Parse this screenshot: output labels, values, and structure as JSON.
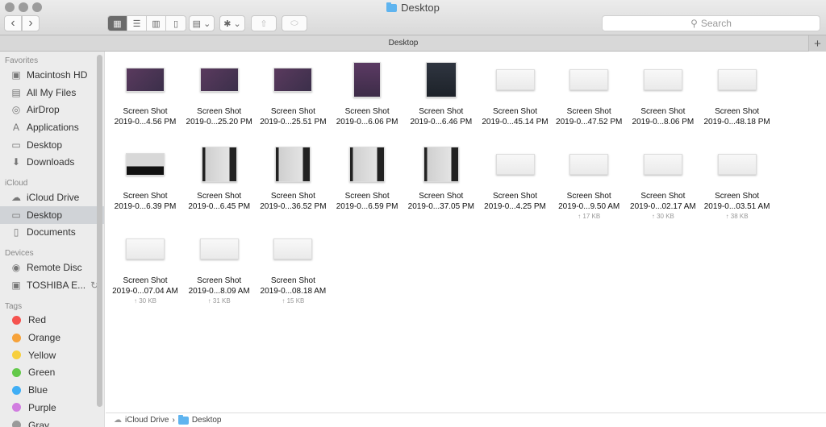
{
  "window": {
    "title": "Desktop",
    "icon": "folder-icon"
  },
  "toolbar": {
    "back_icon": "‹",
    "forward_icon": "›",
    "view_modes": [
      {
        "name": "icon-view",
        "glyph": "▦",
        "active": true
      },
      {
        "name": "list-view",
        "glyph": "☰"
      },
      {
        "name": "column-view",
        "glyph": "▥"
      },
      {
        "name": "gallery-view",
        "glyph": "▯"
      }
    ],
    "arrange_glyph": "▤ ⌄",
    "action_glyph": "✱ ⌄",
    "share_glyph": "⇧",
    "tag_glyph": "⬭",
    "search_placeholder": "Search",
    "search_icon": "⚲"
  },
  "pathbar": {
    "title": "Desktop",
    "add_tab": "+"
  },
  "sidebar": {
    "favorites_label": "Favorites",
    "favorites": [
      {
        "label": "Macintosh HD",
        "icon": "▣"
      },
      {
        "label": "All My Files",
        "icon": "▤"
      },
      {
        "label": "AirDrop",
        "icon": "◎"
      },
      {
        "label": "Applications",
        "icon": "A"
      },
      {
        "label": "Desktop",
        "icon": "▭"
      },
      {
        "label": "Downloads",
        "icon": "⬇"
      }
    ],
    "icloud_label": "iCloud",
    "icloud": [
      {
        "label": "iCloud Drive",
        "icon": "☁"
      },
      {
        "label": "Desktop",
        "icon": "▭",
        "selected": true
      },
      {
        "label": "Documents",
        "icon": "▯"
      }
    ],
    "devices_label": "Devices",
    "devices": [
      {
        "label": "Remote Disc",
        "icon": "◉"
      },
      {
        "label": "TOSHIBA E...",
        "icon": "▣",
        "sync_icon": "↻"
      }
    ],
    "tags_label": "Tags",
    "tags": [
      {
        "label": "Red",
        "color": "#f5534f"
      },
      {
        "label": "Orange",
        "color": "#f6a23a"
      },
      {
        "label": "Yellow",
        "color": "#f7cf3c"
      },
      {
        "label": "Green",
        "color": "#63c94a"
      },
      {
        "label": "Blue",
        "color": "#40aef5"
      },
      {
        "label": "Purple",
        "color": "#d17de0"
      },
      {
        "label": "Gray",
        "color": "#9a9a9a"
      }
    ]
  },
  "files": [
    {
      "name": "Screen Shot",
      "date": "2019-0...4.56 PM",
      "thumb": "purple-wide"
    },
    {
      "name": "Screen Shot",
      "date": "2019-0...25.20 PM",
      "thumb": "purple-wide"
    },
    {
      "name": "Screen Shot",
      "date": "2019-0...25.51 PM",
      "thumb": "purple-wide"
    },
    {
      "name": "Screen Shot",
      "date": "2019-0...6.06 PM",
      "thumb": "purple-tall"
    },
    {
      "name": "Screen Shot",
      "date": "2019-0...6.46 PM",
      "thumb": "dark-tall"
    },
    {
      "name": "Screen Shot",
      "date": "2019-0...45.14 PM",
      "thumb": "light-wide"
    },
    {
      "name": "Screen Shot",
      "date": "2019-0...47.52 PM",
      "thumb": "light-wide"
    },
    {
      "name": "Screen Shot",
      "date": "2019-0...8.06 PM",
      "thumb": "light-wide"
    },
    {
      "name": "Screen Shot",
      "date": "2019-0...48.18 PM",
      "thumb": "light-wide"
    },
    {
      "name": "Screen Shot",
      "date": "2019-0...6.39 PM",
      "thumb": "dark-wide"
    },
    {
      "name": "Screen Shot",
      "date": "2019-0...6.45 PM",
      "thumb": "gray-tall"
    },
    {
      "name": "Screen Shot",
      "date": "2019-0...36.52 PM",
      "thumb": "gray-tall"
    },
    {
      "name": "Screen Shot",
      "date": "2019-0...6.59 PM",
      "thumb": "gray-tall"
    },
    {
      "name": "Screen Shot",
      "date": "2019-0...37.05 PM",
      "thumb": "gray-tall"
    },
    {
      "name": "Screen Shot",
      "date": "2019-0...4.25 PM",
      "thumb": "light-wide"
    },
    {
      "name": "Screen Shot",
      "date": "2019-0...9.50 AM",
      "size": "↑ 17 KB",
      "thumb": "light-wide"
    },
    {
      "name": "Screen Shot",
      "date": "2019-0...02.17 AM",
      "size": "↑ 30 KB",
      "thumb": "light-wide"
    },
    {
      "name": "Screen Shot",
      "date": "2019-0...03.51 AM",
      "size": "↑ 38 KB",
      "thumb": "light-wide"
    },
    {
      "name": "Screen Shot",
      "date": "2019-0...07.04 AM",
      "size": "↑ 30 KB",
      "thumb": "light-wide"
    },
    {
      "name": "Screen Shot",
      "date": "2019-0...8.09 AM",
      "size": "↑ 31 KB",
      "thumb": "light-wide"
    },
    {
      "name": "Screen Shot",
      "date": "2019-0...08.18 AM",
      "size": "↑ 15 KB",
      "thumb": "light-wide"
    }
  ],
  "statusbar": {
    "path": [
      {
        "label": "iCloud Drive",
        "icon": "☁"
      },
      {
        "label": "Desktop",
        "icon": "folder"
      }
    ],
    "separator": "›"
  }
}
